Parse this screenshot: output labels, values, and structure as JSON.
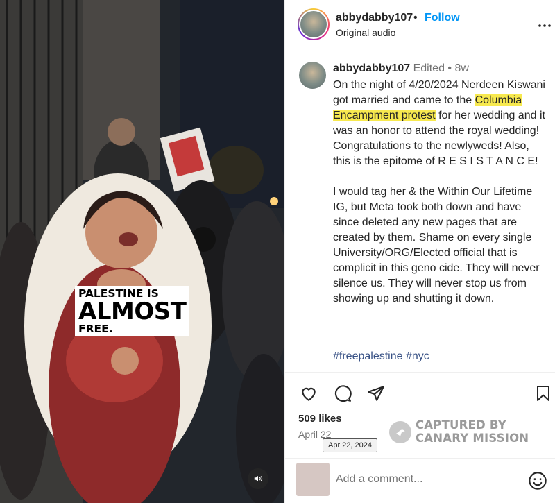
{
  "video": {
    "overlay_line1": "PALESTINE IS",
    "overlay_line2": "ALMOST",
    "overlay_line3": "FREE."
  },
  "header": {
    "username": "abbydabby107",
    "separator": "•",
    "follow_label": "Follow",
    "audio_label": "Original audio"
  },
  "caption": {
    "username": "abbydabby107",
    "meta": "Edited • 8w",
    "p1_a": "On the night of 4/20/2024 Nerdeen Kiswani got married and came to the ",
    "p1_highlight": "Columbia Encampment protest",
    "p1_b": " for her wedding and it was an honor to attend the royal wedding! Congratulations to the newlyweds! Also, this is the epitome of R E S I S T A N C E!",
    "p2": "I would tag her & the Within Our Lifetime IG, but Meta took both down and have since deleted any new pages that are created by them. Shame on every single University/ORG/Elected official that is complicit in this geno cide. They will never silence us. They will never stop us from showing up and shutting it down.",
    "hashtag1": "#freepalestine",
    "hashtag2": "#nyc"
  },
  "actions": {
    "likes": "509 likes",
    "date": "April 22",
    "tooltip": "Apr 22, 2024"
  },
  "watermark": {
    "line1": "CAPTURED BY",
    "line2": "CANARY MISSION"
  },
  "comment": {
    "placeholder": "Add a comment..."
  },
  "icons": {
    "more": "more-options-icon",
    "like": "heart-icon",
    "comment": "comment-icon",
    "share": "share-icon",
    "save": "bookmark-icon",
    "emoji": "emoji-icon",
    "mute": "speaker-icon"
  },
  "colors": {
    "follow": "#0095f6",
    "highlight": "#f7e94f",
    "hashtag": "#385185",
    "muted_text": "#737373"
  }
}
